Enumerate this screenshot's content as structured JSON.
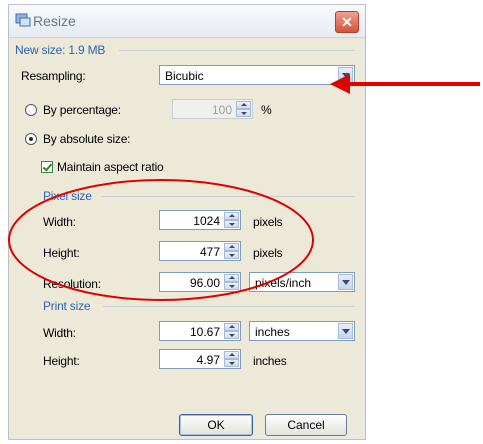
{
  "dialog": {
    "title": "Resize",
    "close_glyph": "✕"
  },
  "new_size": "New size: 1.9 MB",
  "resampling": {
    "label": "Resampling:",
    "value": "Bicubic"
  },
  "by_percentage": {
    "label": "By percentage:",
    "value": "100",
    "unit": "%",
    "selected": false
  },
  "by_absolute": {
    "label": "By absolute size:",
    "selected": true
  },
  "maintain_aspect": {
    "label": "Maintain aspect ratio",
    "checked": true
  },
  "pixel_size": {
    "heading": "Pixel size",
    "width": {
      "label": "Width:",
      "value": "1024",
      "unit": "pixels"
    },
    "height": {
      "label": "Height:",
      "value": "477",
      "unit": "pixels"
    },
    "resolution": {
      "label": "Resolution:",
      "value": "96.00",
      "unit": "pixels/inch"
    }
  },
  "print_size": {
    "heading": "Print size",
    "width": {
      "label": "Width:",
      "value": "10.67",
      "unit": "inches"
    },
    "height": {
      "label": "Height:",
      "value": "4.97",
      "unit": "inches"
    }
  },
  "buttons": {
    "ok": "OK",
    "cancel": "Cancel"
  },
  "colors": {
    "annotation": "#e00000",
    "heading_blue": "#2e63b8"
  },
  "icons": [
    "app-resize-icon",
    "close-icon",
    "dropdown-arrow-icon",
    "spinner-icon",
    "checkmark-icon",
    "annotation-arrow",
    "annotation-ellipse"
  ]
}
